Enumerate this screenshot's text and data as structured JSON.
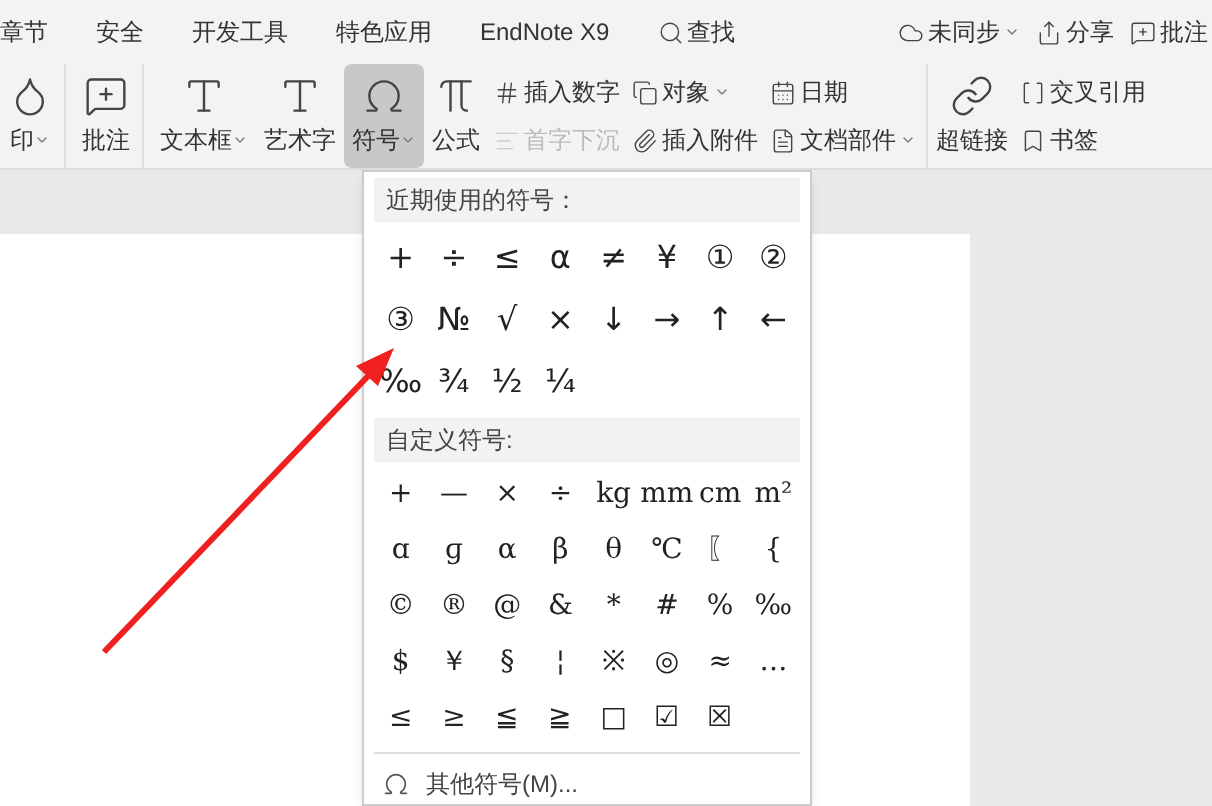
{
  "menu_tabs": [
    {
      "label": "章节"
    },
    {
      "label": "安全"
    },
    {
      "label": "开发工具"
    },
    {
      "label": "特色应用"
    },
    {
      "label": "EndNote X9"
    },
    {
      "label": "查找"
    }
  ],
  "top_right": [
    {
      "label": "未同步",
      "dropdown": true
    },
    {
      "label": "分享",
      "dropdown": false
    },
    {
      "label": "批注",
      "dropdown": false
    }
  ],
  "ribbon": {
    "large": [
      {
        "label": "印",
        "dropdown": true,
        "selected": false
      },
      {
        "label": "批注",
        "dropdown": false,
        "selected": false
      },
      {
        "label": "文本框",
        "dropdown": true,
        "selected": false
      },
      {
        "label": "艺术字",
        "dropdown": false,
        "selected": false
      },
      {
        "label": "符号",
        "dropdown": true,
        "selected": true
      },
      {
        "label": "公式",
        "dropdown": false,
        "selected": false
      }
    ],
    "small_columns": [
      [
        {
          "label": "插入数字",
          "dropdown": false,
          "disabled": false
        },
        {
          "label": "首字下沉",
          "dropdown": false,
          "disabled": true
        }
      ],
      [
        {
          "label": "对象",
          "dropdown": true,
          "disabled": false
        },
        {
          "label": "插入附件",
          "dropdown": false,
          "disabled": false
        }
      ],
      [
        {
          "label": "日期",
          "dropdown": false,
          "disabled": false
        },
        {
          "label": "文档部件",
          "dropdown": true,
          "disabled": false
        }
      ]
    ],
    "link": {
      "label": "超链接"
    },
    "right_small": [
      {
        "label": "交叉引用"
      },
      {
        "label": "书签"
      }
    ]
  },
  "symbol_menu": {
    "recent_title": "近期使用的符号：",
    "recent": [
      "+",
      "÷",
      "≤",
      "α",
      "≠",
      "¥",
      "①",
      "②",
      "③",
      "№",
      "√",
      "×",
      "↓",
      "→",
      "↑",
      "←",
      "‰",
      "¾",
      "½",
      "¼"
    ],
    "custom_title": "自定义符号:",
    "custom": [
      "+",
      "—",
      "×",
      "÷",
      "kg",
      "mm",
      "cm",
      "m²",
      "ɑ",
      "ɡ",
      "α",
      "β",
      "θ",
      "℃",
      "〖",
      "{",
      "©",
      "®",
      "@",
      "&",
      "*",
      "#",
      "%",
      "‰",
      "$",
      "￥",
      "§",
      "¦",
      "※",
      "◎",
      "≈",
      "…",
      "≤",
      "≥",
      "≦",
      "≧",
      "□",
      "☑",
      "☒"
    ],
    "more": "其他符号(M)..."
  }
}
